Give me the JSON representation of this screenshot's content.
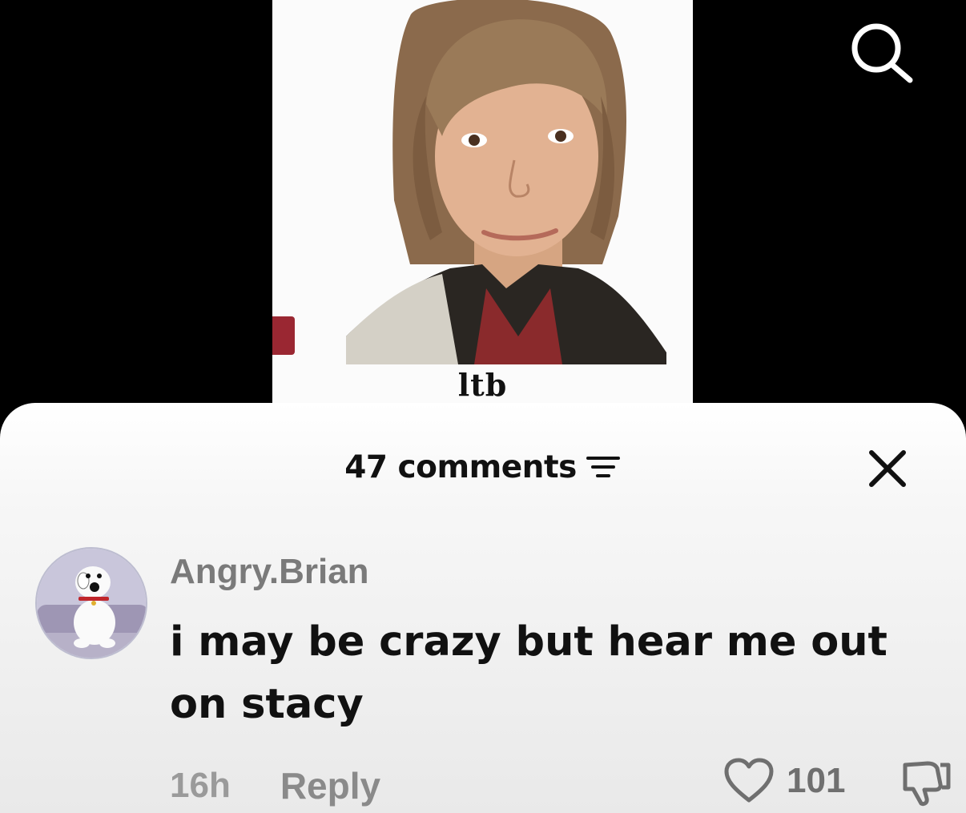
{
  "video": {
    "caption": "ltb"
  },
  "top_bar": {
    "search_icon": "search-icon"
  },
  "comments_sheet": {
    "count_label": "47 comments",
    "filter_icon": "filter-icon",
    "close_icon": "close-icon"
  },
  "comment": {
    "avatar_icon": "avatar-cartoon-dog",
    "username": "Angry.Brian",
    "text": "i may be crazy but hear me out on stacy",
    "timestamp": "16h",
    "reply_label": "Reply",
    "like_icon": "heart-icon",
    "like_count": "101",
    "dislike_icon": "thumbs-down-icon"
  },
  "colors": {
    "background": "#000000",
    "sheet": "#f4f4f4",
    "primary_text": "#111111",
    "secondary_text": "#8a8a8a"
  }
}
